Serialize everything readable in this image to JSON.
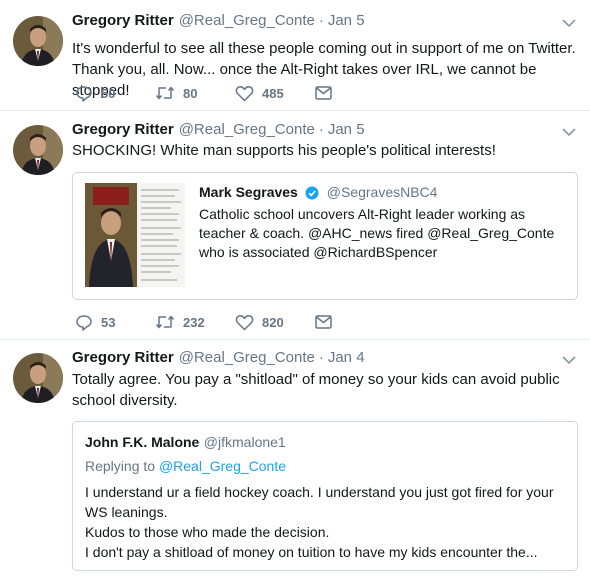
{
  "tweets": [
    {
      "name": "Gregory Ritter",
      "handle": "@Real_Greg_Conte",
      "separator": "·",
      "date": "Jan 5",
      "text": "It's wonderful to see all these people coming out in support of me on Twitter.\nThank you, all. Now... once the Alt-Right takes over IRL, we cannot be stopped!",
      "replies": "50",
      "retweets": "80",
      "likes": "485"
    },
    {
      "name": "Gregory Ritter",
      "handle": "@Real_Greg_Conte",
      "separator": "·",
      "date": "Jan 5",
      "text": "SHOCKING! White man supports his people's political interests!",
      "quote": {
        "name": "Mark Segraves",
        "handle": "@SegravesNBC4",
        "text": "Catholic school uncovers Alt-Right leader working as\nteacher & coach. @AHC_news fired @Real_Greg_Conte\nwho is associated @RichardBSpencer"
      },
      "replies": "53",
      "retweets": "232",
      "likes": "820"
    },
    {
      "name": "Gregory Ritter",
      "handle": "@Real_Greg_Conte",
      "separator": "·",
      "date": "Jan 4",
      "text": "Totally agree. You pay a \"shitload\" of money so your kids can avoid public\nschool diversity.",
      "quote": {
        "name": "John F.K. Malone",
        "handle": "@jfkmalone1",
        "reply_prefix": "Replying to",
        "reply_to": "@Real_Greg_Conte",
        "text": "I understand ur a field hockey coach. I understand you just got fired for your\nWS leanings.\nKudos to those who made the decision.\nI don't pay a shitload of money on tuition to have my kids encounter the..."
      }
    }
  ],
  "icons": {
    "reply": "reply-icon",
    "retweet": "retweet-icon",
    "like": "heart-icon",
    "dm": "envelope-icon",
    "menu": "chevron-down-icon",
    "verified": "verified-badge-icon"
  },
  "colors": {
    "text": "#14171a",
    "muted": "#657786",
    "link": "#1da1f2",
    "border": "#e6ecf0"
  }
}
